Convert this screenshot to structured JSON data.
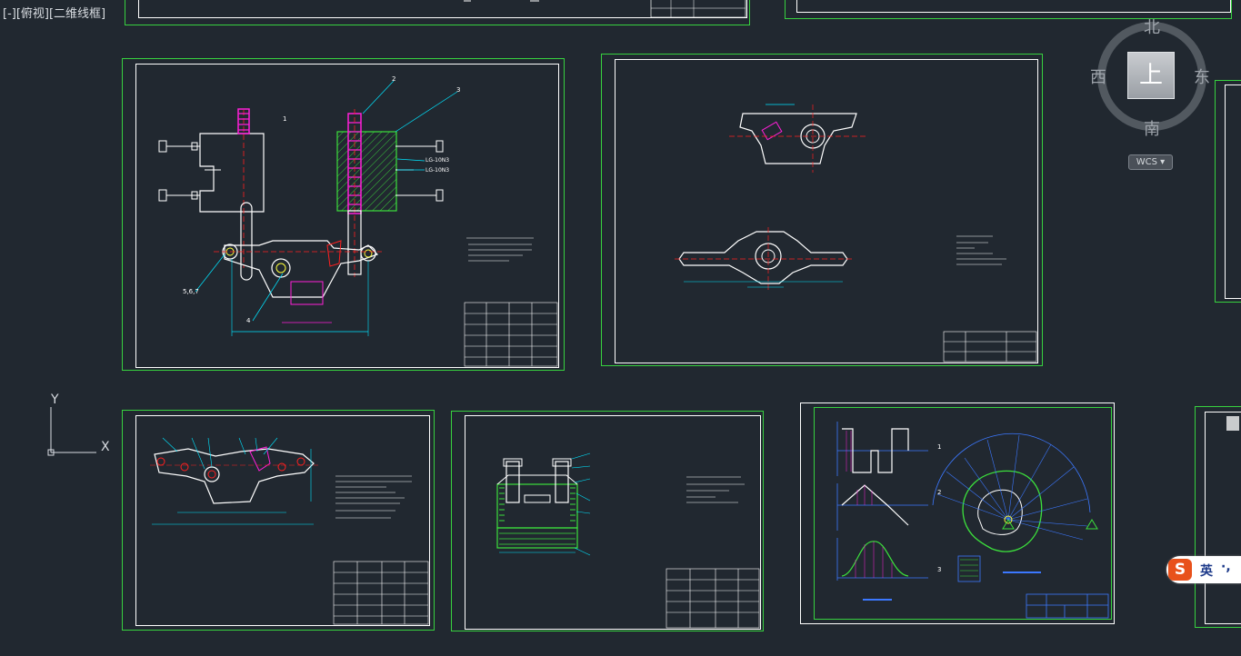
{
  "viewport": {
    "label": "[-][俯视][二维线框]"
  },
  "viewcube": {
    "top_face": "上",
    "north": "北",
    "south": "南",
    "east": "东",
    "west": "西",
    "wcs_label": "WCS"
  },
  "ucs": {
    "x_label": "X",
    "y_label": "Y"
  },
  "ime": {
    "logo": "S",
    "lang": "英",
    "punct": "·,"
  },
  "colors": {
    "background": "#212830",
    "sheet_border": "#37d13f",
    "inner_border": "#ffffff",
    "cyan": "#00e5ff",
    "magenta": "#ff1fd8",
    "red": "#ff2020",
    "green": "#3ce03c",
    "yellow": "#ffff3c",
    "blue": "#3c78ff"
  },
  "drawings": {
    "assembly_sheet": {
      "part_labels": [
        "1",
        "2",
        "3",
        "5,6,7",
        "4"
      ],
      "callouts": [
        "LG-10N3"
      ]
    },
    "cam_sheet": {
      "labels": [
        "1",
        "2",
        "3"
      ]
    }
  },
  "icons": [
    "viewcube-compass",
    "ucs-axes-icon",
    "ime-logo-icon"
  ]
}
